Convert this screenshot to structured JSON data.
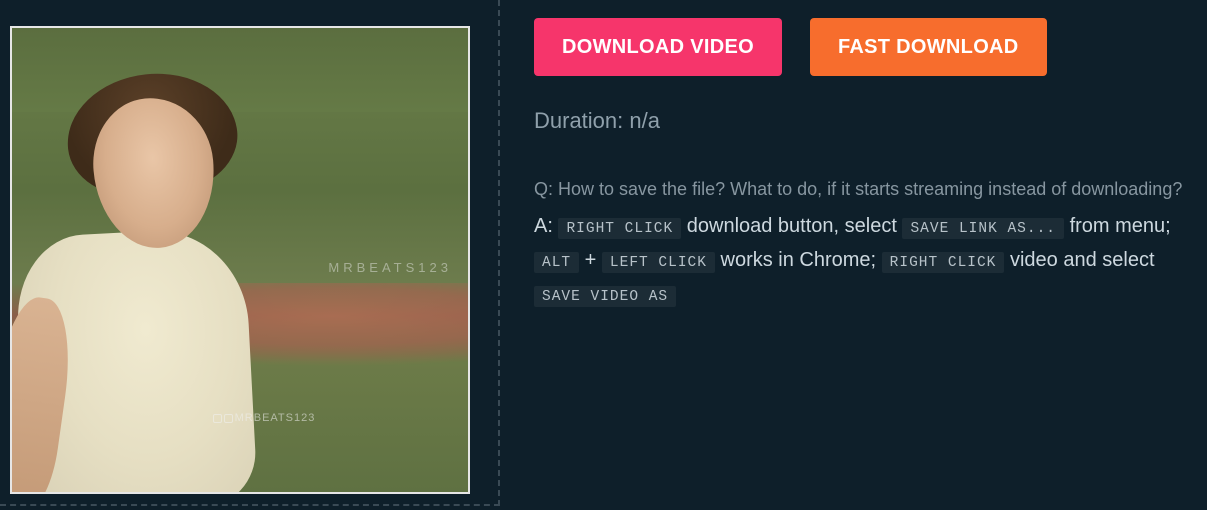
{
  "thumbnail": {
    "watermark_top": "MRBEATS123",
    "watermark_bottom": "MRBEATS123"
  },
  "buttons": {
    "download": "DOWNLOAD VIDEO",
    "fast": "FAST DOWNLOAD"
  },
  "duration": {
    "label": "Duration:",
    "value": "n/a"
  },
  "faq": {
    "question": "Q: How to save the file? What to do, if it starts streaming instead of downloading?",
    "answer_prefix": "A:",
    "kbd_right_click": "RIGHT CLICK",
    "txt_download_button": "download button, select",
    "kbd_save_link_as": "SAVE LINK AS...",
    "txt_from_menu": "from menu;",
    "kbd_alt": "ALT",
    "txt_plus": "+",
    "kbd_left_click": "LEFT CLICK",
    "txt_works_chrome": "works in Chrome;",
    "kbd_right_click2": "RIGHT CLICK",
    "txt_video_select": "video and select",
    "kbd_save_video_as": "SAVE VIDEO AS"
  }
}
